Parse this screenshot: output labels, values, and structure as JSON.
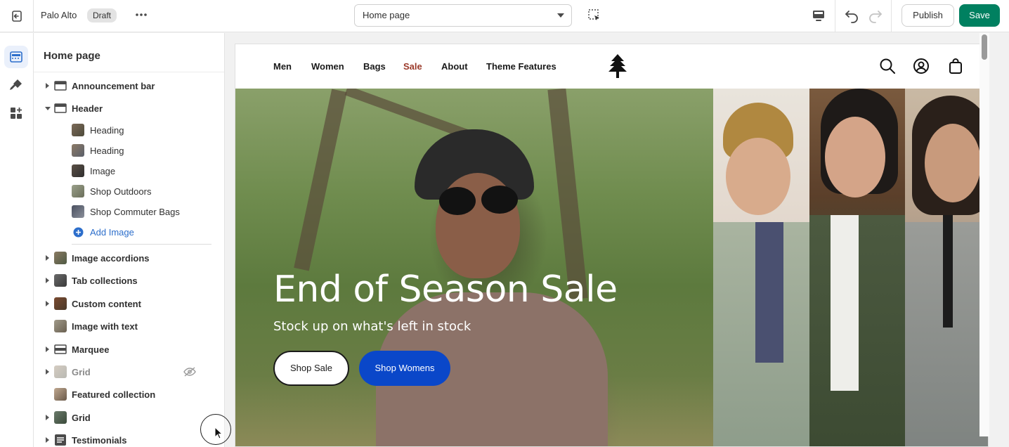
{
  "topbar": {
    "store_name": "Palo Alto",
    "status_badge": "Draft",
    "page_select": "Home page",
    "publish_label": "Publish",
    "save_label": "Save"
  },
  "sidebar": {
    "title": "Home page",
    "sections": [
      {
        "label": "Announcement bar",
        "expanded": false,
        "icon": "section-bar-icon"
      },
      {
        "label": "Header",
        "expanded": true,
        "icon": "section-bar-icon",
        "blocks": [
          {
            "label": "Heading"
          },
          {
            "label": "Heading"
          },
          {
            "label": "Image"
          },
          {
            "label": "Shop Outdoors"
          },
          {
            "label": "Shop Commuter Bags"
          }
        ],
        "add_label": "Add Image"
      },
      {
        "label": "Image accordions",
        "expanded": false
      },
      {
        "label": "Tab collections",
        "expanded": false
      },
      {
        "label": "Custom content",
        "expanded": false
      },
      {
        "label": "Image with text",
        "expanded": false
      },
      {
        "label": "Marquee",
        "expanded": false
      },
      {
        "label": "Grid",
        "expanded": false,
        "hidden": true
      },
      {
        "label": "Featured collection",
        "expanded": false
      },
      {
        "label": "Grid",
        "expanded": false
      },
      {
        "label": "Testimonials",
        "expanded": false
      }
    ]
  },
  "preview": {
    "nav": [
      "Men",
      "Women",
      "Bags",
      "Sale",
      "About",
      "Theme Features"
    ],
    "hero_title": "End of Season Sale",
    "hero_subtitle": "Stock up on what's left in stock",
    "btn_sale": "Shop Sale",
    "btn_womens": "Shop Womens"
  },
  "colors": {
    "save": "#008060",
    "sale_nav": "#9b3a2a",
    "primary_button": "#0a47c9",
    "link": "#2c6ecb"
  }
}
